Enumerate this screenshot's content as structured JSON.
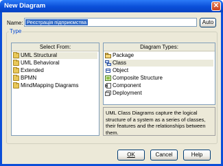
{
  "window": {
    "title": "New Diagram",
    "close_glyph": "✕"
  },
  "name": {
    "label": "Name:",
    "value": "Реєстрація підприємства",
    "auto_label": "Auto"
  },
  "type_group": {
    "label": "Type"
  },
  "select_from": {
    "header": "Select From:",
    "items": [
      {
        "label": "UML Structural",
        "icon": "folder-icon",
        "selected": true
      },
      {
        "label": "UML Behavioral",
        "icon": "folder-icon"
      },
      {
        "label": "Extended",
        "icon": "folder-icon"
      },
      {
        "label": "BPMN",
        "icon": "folder-icon"
      },
      {
        "label": "MindMapping Diagrams",
        "icon": "folder-icon"
      }
    ]
  },
  "diagram_types": {
    "header": "Diagram Types:",
    "items": [
      {
        "label": "Package",
        "icon": "package-icon"
      },
      {
        "label": "Class",
        "icon": "class-icon",
        "selected": true
      },
      {
        "label": "Object",
        "icon": "object-icon"
      },
      {
        "label": "Composite Structure",
        "icon": "composite-structure-icon"
      },
      {
        "label": "Component",
        "icon": "component-icon"
      },
      {
        "label": "Deployment",
        "icon": "deployment-icon"
      }
    ]
  },
  "description": "UML Class Diagrams capture the logical structure of a system as a series of classes, their features and the relationships between them.",
  "buttons": {
    "ok": "OK",
    "cancel": "Cancel",
    "help": "Help"
  },
  "colors": {
    "title_bar": "#0a4fd9",
    "selection": "#316ac5",
    "group_label": "#0046d5",
    "dialog_bg": "#ece9d8"
  }
}
